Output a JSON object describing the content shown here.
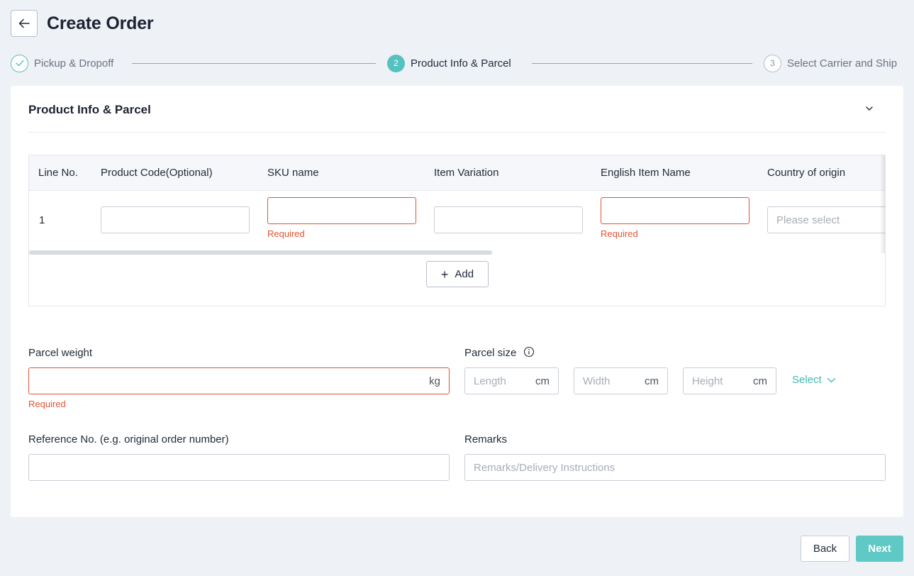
{
  "header": {
    "title": "Create Order",
    "back_icon": "arrow-left-icon"
  },
  "stepper": {
    "steps": [
      {
        "number": "1",
        "label": "Pickup & Dropoff",
        "state": "done"
      },
      {
        "number": "2",
        "label": "Product Info & Parcel",
        "state": "active"
      },
      {
        "number": "3",
        "label": "Select Carrier and Ship",
        "state": "pending"
      }
    ]
  },
  "section": {
    "title": "Product Info & Parcel",
    "collapse_icon": "chevron-down-icon",
    "table": {
      "columns": [
        "Line No.",
        "Product Code(Optional)",
        "SKU name",
        "Item Variation",
        "English Item Name",
        "Country of origin"
      ],
      "rows": [
        {
          "line_no": "1",
          "product_code": "",
          "sku_name": "",
          "item_variation": "",
          "english_item_name": "",
          "country_of_origin_placeholder": "Please select"
        }
      ],
      "required_text": "Required",
      "add_label": "Add"
    },
    "parcel_weight": {
      "label": "Parcel weight",
      "value": "",
      "unit": "kg",
      "error": "Required"
    },
    "parcel_size": {
      "label": "Parcel size",
      "length_placeholder": "Length",
      "width_placeholder": "Width",
      "height_placeholder": "Height",
      "unit": "cm",
      "select_label": "Select"
    },
    "reference": {
      "label": "Reference No. (e.g. original order number)",
      "value": ""
    },
    "remarks": {
      "label": "Remarks",
      "placeholder": "Remarks/Delivery Instructions"
    }
  },
  "footer": {
    "back_label": "Back",
    "next_label": "Next"
  },
  "colors": {
    "accent": "#55c2c0",
    "error": "#e25433",
    "background": "#eef1f6"
  }
}
